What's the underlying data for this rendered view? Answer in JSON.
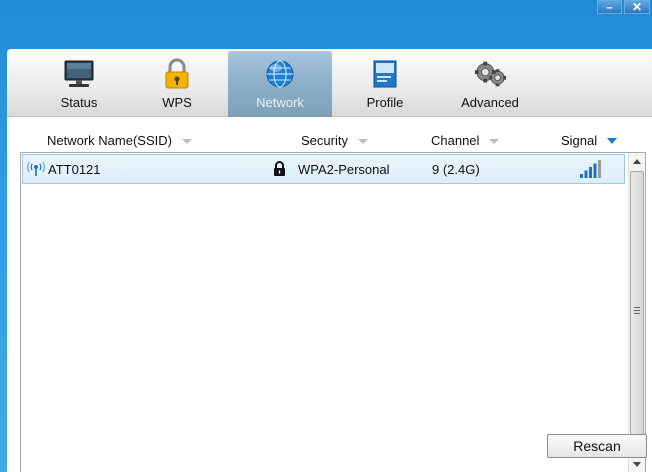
{
  "window": {
    "minimize_label": "–",
    "close_label": "✕"
  },
  "toolbar": {
    "tabs": [
      {
        "label": "Status",
        "icon": "monitor-icon",
        "active": false
      },
      {
        "label": "WPS",
        "icon": "lock-icon",
        "active": false
      },
      {
        "label": "Network",
        "icon": "globe-icon",
        "active": true
      },
      {
        "label": "Profile",
        "icon": "profile-icon",
        "active": false
      },
      {
        "label": "Advanced",
        "icon": "gears-icon",
        "active": false
      }
    ]
  },
  "table": {
    "columns": [
      {
        "label": "Network Name(SSID)",
        "sorted": false
      },
      {
        "label": "Security",
        "sorted": false
      },
      {
        "label": "Channel",
        "sorted": false
      },
      {
        "label": "Signal",
        "sorted": true
      }
    ],
    "rows": [
      {
        "ssid": "ATT0121",
        "locked": true,
        "security": "WPA2-Personal",
        "channel": "9 (2.4G)",
        "signal_bars": 5,
        "signal_level": 4
      }
    ]
  },
  "buttons": {
    "rescan_label": "Rescan"
  },
  "colors": {
    "accent": "#1e7ad0",
    "active_tab": "#8eb0c9",
    "signal_active": "#1e6fc8",
    "signal_inactive": "#9a9a9a"
  }
}
